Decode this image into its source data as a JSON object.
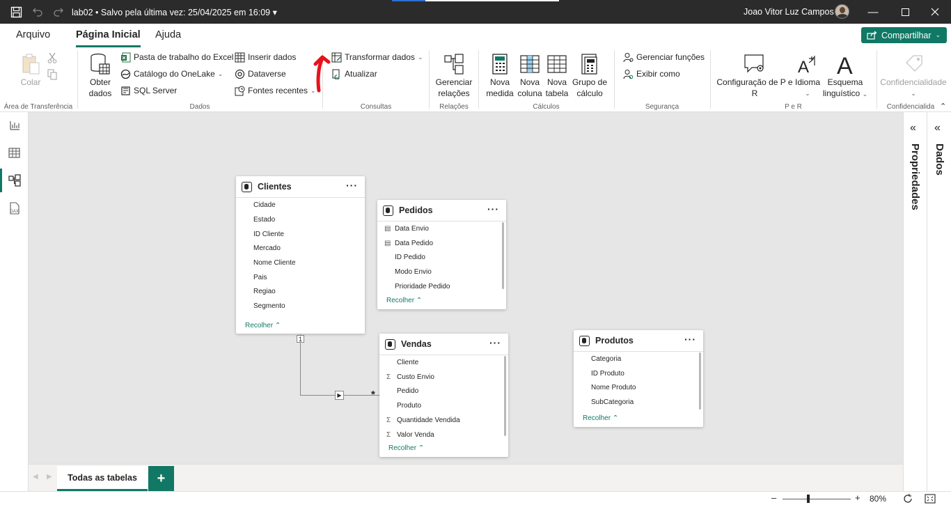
{
  "titlebar": {
    "title": "lab02 • Salvo pela última vez: 25/04/2025 em 16:09 ▾",
    "user": "Joao Vitor Luz Campos"
  },
  "menu": {
    "tabs": [
      "Arquivo",
      "Página Inicial",
      "Ajuda"
    ],
    "share": "Compartilhar"
  },
  "ribbon": {
    "clipboard": {
      "paste": "Colar",
      "group": "Área de Transferência"
    },
    "data": {
      "get_data": "Obter dados",
      "excel": "Pasta de trabalho do Excel",
      "onelake": "Catálogo do OneLake",
      "sql": "SQL Server",
      "insert": "Inserir dados",
      "dataverse": "Dataverse",
      "recent": "Fontes recentes",
      "group": "Dados"
    },
    "queries": {
      "transform": "Transformar dados",
      "refresh": "Atualizar",
      "group": "Consultas"
    },
    "relations": {
      "manage_1": "Gerenciar",
      "manage_2": "relações",
      "group": "Relações"
    },
    "calcs": {
      "new_measure_1": "Nova",
      "new_measure_2": "medida",
      "new_column_1": "Nova",
      "new_column_2": "coluna",
      "new_table_1": "Nova",
      "new_table_2": "tabela",
      "calc_group_1": "Grupo de",
      "calc_group_2": "cálculo",
      "group": "Cálculos"
    },
    "security": {
      "manage_roles": "Gerenciar funções",
      "view_as": "Exibir como",
      "group": "Segurança"
    },
    "qa": {
      "config_1": "Configuração de P e",
      "config_2": "R",
      "language": "Idioma",
      "schema_1": "Esquema",
      "schema_2": "linguístico",
      "group": "P e R"
    },
    "sensitivity": {
      "label": "Confidencialidade",
      "group": "Confidencialida"
    }
  },
  "tables": {
    "clientes": {
      "name": "Clientes",
      "fields": [
        "Cidade",
        "Estado",
        "ID Cliente",
        "Mercado",
        "Nome Cliente",
        "Pais",
        "Regiao",
        "Segmento"
      ],
      "collapse": "Recolher"
    },
    "pedidos": {
      "name": "Pedidos",
      "fields": [
        "Data Envio",
        "Data Pedido",
        "ID Pedido",
        "Modo Envio",
        "Prioridade Pedido"
      ],
      "collapse": "Recolher"
    },
    "vendas": {
      "name": "Vendas",
      "fields": [
        "Cliente",
        "Custo Envio",
        "Pedido",
        "Produto",
        "Quantidade Vendida",
        "Valor Venda"
      ],
      "collapse": "Recolher"
    },
    "produtos": {
      "name": "Produtos",
      "fields": [
        "Categoria",
        "ID Produto",
        "Nome Produto",
        "SubCategoria"
      ],
      "collapse": "Recolher"
    }
  },
  "relationship": {
    "one": "1",
    "many": "*"
  },
  "right_panes": {
    "properties": "Propriedades",
    "data": "Dados"
  },
  "bottom": {
    "page_tab": "Todas as tabelas",
    "add": "+"
  },
  "status": {
    "zoom": "80%"
  },
  "colors": {
    "accent": "#117865",
    "annotation_arrow": "#e8111a"
  }
}
